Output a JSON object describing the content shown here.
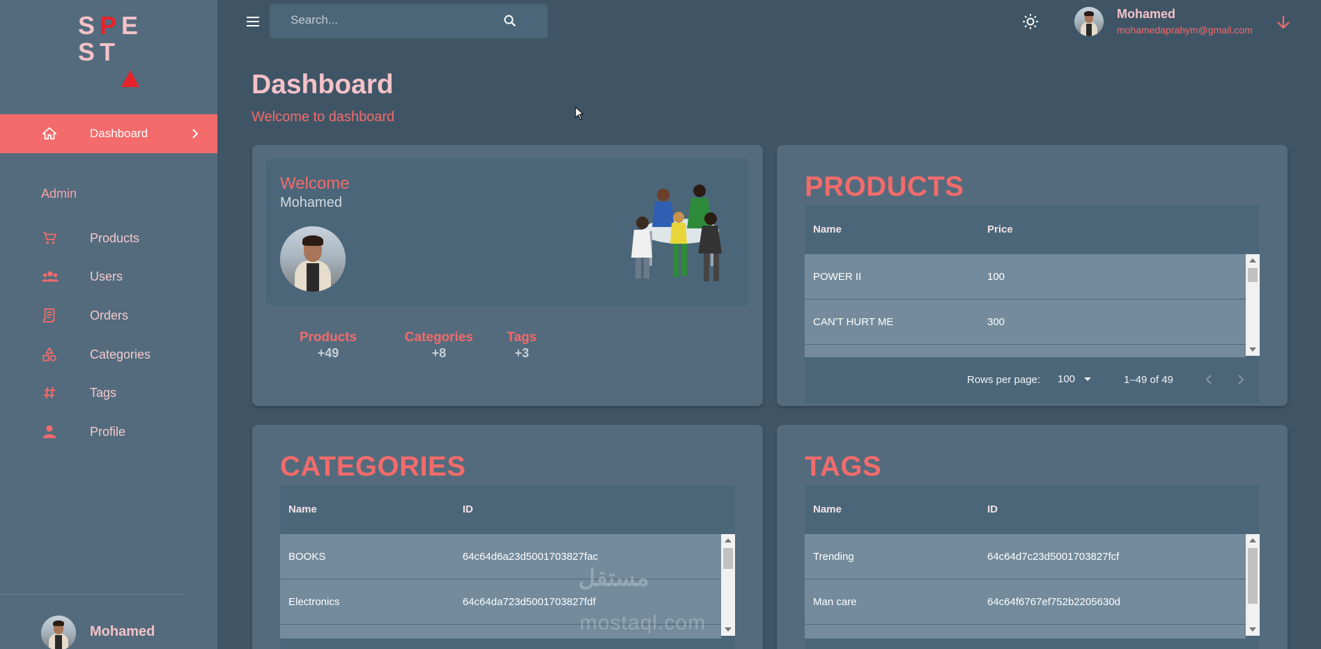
{
  "brand": {
    "logo_row1": [
      "S",
      "P",
      "E"
    ],
    "logo_row2": [
      "S",
      "T"
    ],
    "logo_accent": "#e6222b"
  },
  "colors": {
    "accent": "#f36b6b",
    "sidebar": "#536b7d",
    "background": "#3f5566",
    "card": "#536b7d"
  },
  "sidebar": {
    "active_item": {
      "label": "Dashboard",
      "icon": "home-icon"
    },
    "section_label": "Admin",
    "items": [
      {
        "label": "Products",
        "icon": "cart-icon"
      },
      {
        "label": "Users",
        "icon": "users-icon"
      },
      {
        "label": "Orders",
        "icon": "receipt-icon"
      },
      {
        "label": "Categories",
        "icon": "category-icon"
      },
      {
        "label": "Tags",
        "icon": "hashtag-icon"
      },
      {
        "label": "Profile",
        "icon": "person-icon"
      }
    ],
    "user_name": "Mohamed"
  },
  "topbar": {
    "search_placeholder": "Search...",
    "user_name": "Mohamed",
    "user_email": "mohamedaprahym@gmail.com"
  },
  "page": {
    "title": "Dashboard",
    "subtitle": "Welcome to dashboard"
  },
  "welcome": {
    "title": "Welcome",
    "name": "Mohamed",
    "stats": [
      {
        "label": "Products",
        "value": "+49"
      },
      {
        "label": "Categories",
        "value": "+8"
      },
      {
        "label": "Tags",
        "value": "+3"
      }
    ]
  },
  "products": {
    "title": "PRODUCTS",
    "columns": [
      "Name",
      "Price"
    ],
    "rows": [
      [
        "POWER II",
        "100"
      ],
      [
        "CAN'T HURT ME",
        "300"
      ]
    ],
    "pager": {
      "rows_per_page_label": "Rows per page:",
      "rows_per_page": "100",
      "range": "1–49 of 49"
    }
  },
  "categories": {
    "title": "CATEGORIES",
    "columns": [
      "Name",
      "ID"
    ],
    "rows": [
      [
        "BOOKS",
        "64c64d6a23d5001703827fac"
      ],
      [
        "Electronics",
        "64c64da723d5001703827fdf"
      ]
    ]
  },
  "tags": {
    "title": "TAGS",
    "columns": [
      "Name",
      "ID"
    ],
    "rows": [
      [
        "Trending",
        "64c64d7c23d5001703827fcf"
      ],
      [
        "Man care",
        "64c64f6767ef752b2205630d"
      ]
    ]
  },
  "watermark": {
    "arabic": "مستقل",
    "latin": "mostaql.com"
  }
}
